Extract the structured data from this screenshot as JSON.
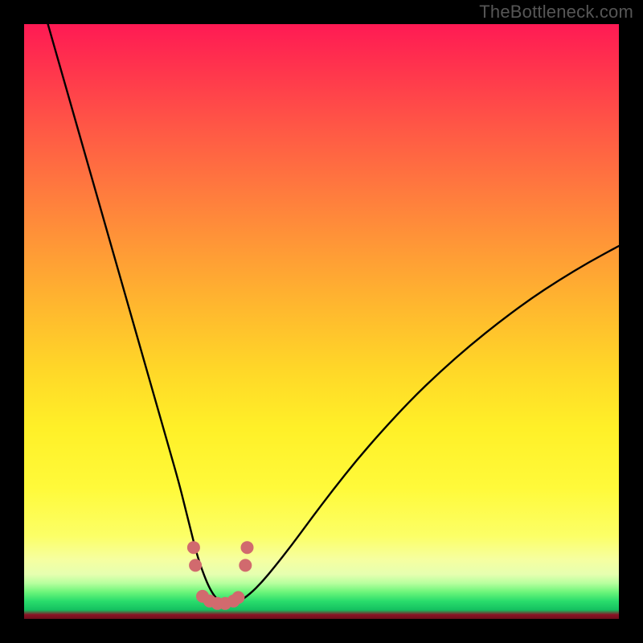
{
  "watermark": "TheBottleneck.com",
  "colors": {
    "curve": "#000000",
    "point": "#d16a6e",
    "background_black": "#000000"
  },
  "chart_data": {
    "type": "line",
    "title": "",
    "xlabel": "",
    "ylabel": "",
    "xlim": [
      0,
      100
    ],
    "ylim": [
      0,
      100
    ],
    "note": "x and y are percentages of plot width/height; y=0 is bottom, y=100 is top. The curve is the black bottleneck-style V-shape; scatter points are the small salmon dots near the trough.",
    "series": [
      {
        "name": "bottleneck-curve",
        "type": "line",
        "x": [
          4,
          6,
          8,
          10,
          12,
          14,
          16,
          18,
          20,
          22,
          24,
          26,
          27,
          28,
          29,
          30,
          31,
          32,
          33,
          34,
          35,
          36,
          38,
          40,
          42,
          45,
          48,
          52,
          56,
          60,
          65,
          70,
          75,
          80,
          85,
          90,
          95,
          100
        ],
        "y": [
          100,
          93,
          86,
          79,
          72,
          65,
          58,
          51,
          44,
          37,
          30,
          23,
          19,
          15,
          11,
          8,
          5.5,
          3.8,
          2.8,
          2.4,
          2.4,
          2.8,
          4.2,
          6.2,
          8.6,
          12.4,
          16.5,
          21.8,
          26.8,
          31.4,
          36.8,
          41.6,
          46.0,
          50.0,
          53.7,
          57.0,
          60.0,
          62.7
        ]
      },
      {
        "name": "highlight-points",
        "type": "scatter",
        "x": [
          28.5,
          28.8,
          30.0,
          31.2,
          32.5,
          33.8,
          35.2,
          36.0,
          37.2,
          37.5
        ],
        "y": [
          12.0,
          9.0,
          3.8,
          3.0,
          2.6,
          2.6,
          3.0,
          3.6,
          9.0,
          12.0
        ]
      }
    ]
  }
}
